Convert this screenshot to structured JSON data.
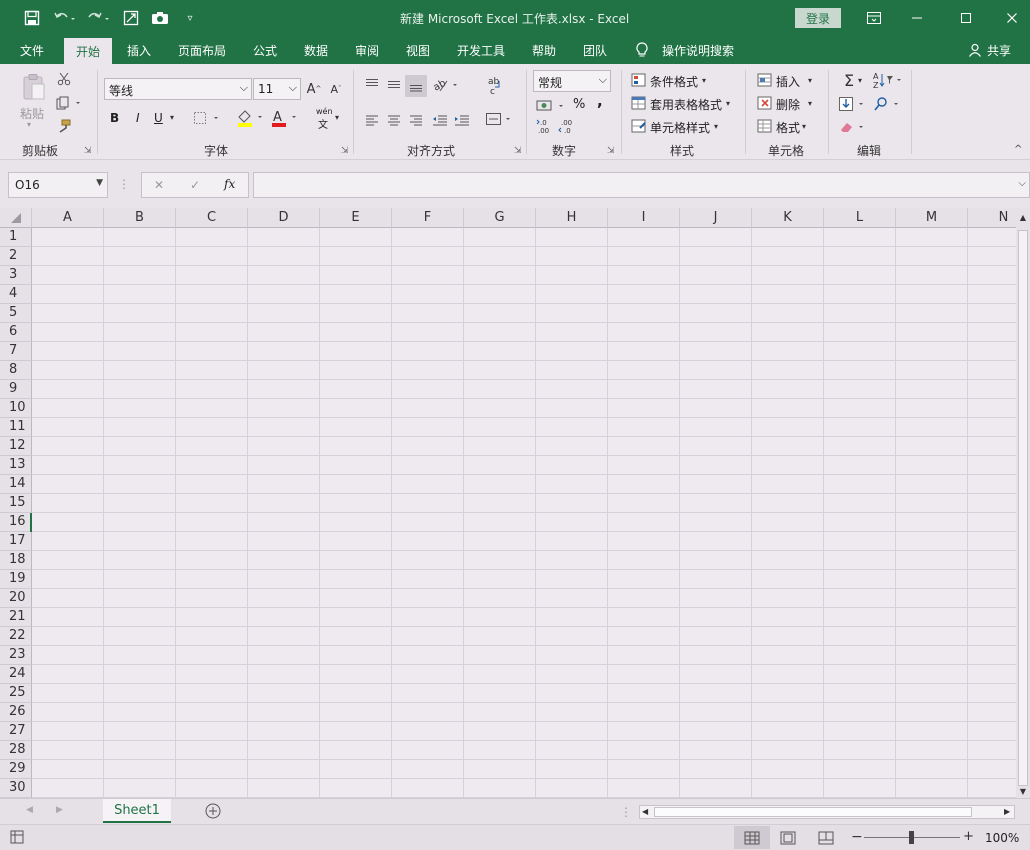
{
  "titlebar": {
    "title": "新建 Microsoft Excel 工作表.xlsx  -  Excel",
    "login": "登录",
    "icons": [
      "save-icon",
      "undo-icon",
      "redo-icon",
      "screenshot-tool-icon",
      "camera-icon",
      "customize-qat-icon"
    ],
    "window_buttons": [
      "ribbon-display-options-icon",
      "minimize-icon",
      "maximize-icon",
      "close-icon"
    ]
  },
  "menubar": {
    "tabs": [
      "文件",
      "开始",
      "插入",
      "页面布局",
      "公式",
      "数据",
      "审阅",
      "视图",
      "开发工具",
      "帮助",
      "团队"
    ],
    "active_tab": "开始",
    "tell_me": "操作说明搜索",
    "share": "共享"
  },
  "ribbon": {
    "clipboard": {
      "paste": "粘贴",
      "label": "剪贴板"
    },
    "font": {
      "name": "等线",
      "size": "11",
      "label": "字体",
      "bold": "B",
      "italic": "I",
      "underline": "U",
      "wen": "wén",
      "wen_char": "文"
    },
    "alignment": {
      "label": "对齐方式"
    },
    "number": {
      "format": "常规",
      "percent": "%",
      "comma": ",",
      "label": "数字"
    },
    "styles": {
      "conditional": "条件格式",
      "table": "套用表格格式",
      "cell_styles": "单元格样式",
      "label": "样式"
    },
    "cells": {
      "insert": "插入",
      "delete": "删除",
      "format": "格式",
      "label": "单元格"
    },
    "editing": {
      "label": "编辑"
    },
    "accent": "#217346"
  },
  "formula_bar": {
    "name_box": "O16",
    "fx": "fx",
    "formula": ""
  },
  "grid": {
    "columns": [
      "A",
      "B",
      "C",
      "D",
      "E",
      "F",
      "G",
      "H",
      "I",
      "J",
      "K",
      "L",
      "M",
      "N"
    ],
    "rows": [
      "1",
      "2",
      "3",
      "4",
      "5",
      "6",
      "7",
      "8",
      "9",
      "10",
      "11",
      "12",
      "13",
      "14",
      "15",
      "16",
      "17",
      "18",
      "19",
      "20",
      "21",
      "22",
      "23",
      "24",
      "25",
      "26",
      "27",
      "28",
      "29",
      "30"
    ]
  },
  "sheets": {
    "tabs": [
      "Sheet1"
    ],
    "active": "Sheet1"
  },
  "status": {
    "zoom": "100%"
  }
}
